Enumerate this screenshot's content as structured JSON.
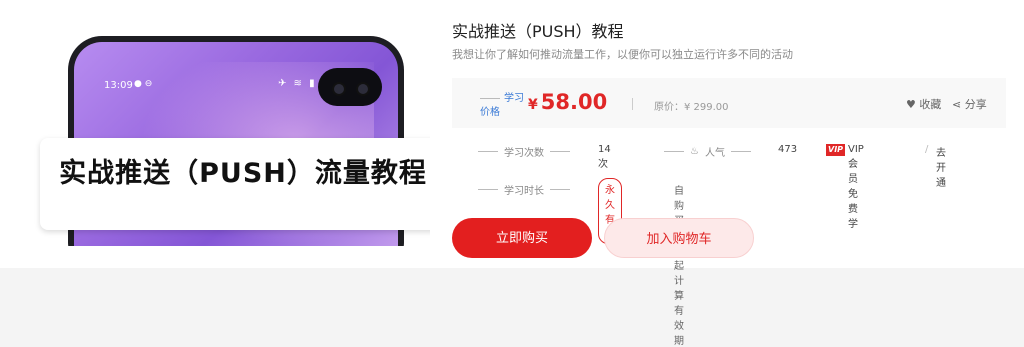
{
  "cover": {
    "status_time": "13:09",
    "banner_text": "实战推送（PUSH）流量教程"
  },
  "course": {
    "title": "实战推送（PUSH）教程",
    "subtitle": "我想让你了解如何推动流量工作，以便你可以独立运行许多不同的活动"
  },
  "price": {
    "label": "学习价格",
    "currency": "¥",
    "amount": "58.00",
    "original": "原价：¥ 299.00",
    "favorite_label": "收藏",
    "share_label": "分享"
  },
  "stats": {
    "study_count_label": "学习次数",
    "study_count_value": "14 次",
    "popularity_label": "人气",
    "popularity_value": "473",
    "vip_badge": "VIP",
    "vip_text": "VIP会员免费学",
    "vip_separator": "/",
    "vip_open": "去开通",
    "duration_label": "学习时长",
    "duration_badge": "永久有效",
    "duration_note": "自购买之日起计算有效期"
  },
  "actions": {
    "buy": "立即购买",
    "cart": "加入购物车"
  },
  "colors": {
    "accent": "#e02727",
    "link": "#3a7ad6"
  }
}
